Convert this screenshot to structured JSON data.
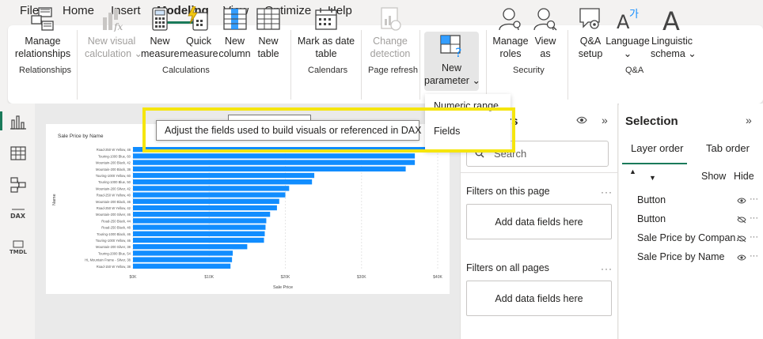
{
  "menu": {
    "items": [
      "File",
      "Home",
      "Insert",
      "Modeling",
      "View",
      "Optimize",
      "Help"
    ],
    "active": "Modeling"
  },
  "ribbon": {
    "manage_relationships": [
      "Manage",
      "relationships"
    ],
    "new_visual_calculation": [
      "New visual",
      "calculation ⌄"
    ],
    "new_measure": [
      "New",
      "measure"
    ],
    "quick_measure": [
      "Quick",
      "measure"
    ],
    "new_column": [
      "New",
      "column"
    ],
    "new_table": [
      "New",
      "table"
    ],
    "mark_as_date_table": [
      "Mark as date",
      "table"
    ],
    "change_detection": [
      "Change",
      "detection"
    ],
    "new_parameter": [
      "New",
      "parameter ⌄"
    ],
    "manage_roles": [
      "Manage",
      "roles"
    ],
    "view_as": [
      "View",
      "as"
    ],
    "qa_setup": [
      "Q&A",
      "setup"
    ],
    "language": [
      "Language",
      "⌄"
    ],
    "linguistic_schema": [
      "Linguistic",
      "schema ⌄"
    ],
    "groups": {
      "relationships": "Relationships",
      "calculations": "Calculations",
      "calendars": "Calendars",
      "page_refresh": "Page refresh",
      "security": "Security",
      "qa": "Q&A"
    }
  },
  "dropdown": {
    "items": [
      "Numeric range",
      "Fields"
    ]
  },
  "tooltip": {
    "text": "Adjust the fields used to build visuals or referenced in DAX"
  },
  "filters": {
    "title": "ers",
    "search_placeholder": "Search",
    "on_this_page": "Filters on this page",
    "on_all_pages": "Filters on all pages",
    "add_fields": "Add data fields here",
    "more": "···"
  },
  "selection": {
    "title": "Selection",
    "tabs": [
      "Layer order",
      "Tab order"
    ],
    "show": "Show",
    "hide": "Hide",
    "items": [
      {
        "name": "Button",
        "visible": true
      },
      {
        "name": "Button",
        "visible": false
      },
      {
        "name": "Sale Price by Compan…",
        "visible": false
      },
      {
        "name": "Sale Price by Name",
        "visible": true
      }
    ],
    "more": "···"
  },
  "chart_data": {
    "type": "bar",
    "title": "Sale Price by Name",
    "xlabel": "Sale Price",
    "ylabel": "Name",
    "xlim": [
      0,
      40000
    ],
    "xticks": [
      "$0K",
      "$10K",
      "$20K",
      "$30K",
      "$40K"
    ],
    "categories": [
      "Road-250 W Yellow, 48",
      "Touring-1000 Blue, 60",
      "Mountain-200 Black, 42",
      "Mountain-200 Black, 38",
      "Touring-1000 Yellow, 60",
      "Touring-1000 Blue, 50",
      "Mountain-200 Silver, 42",
      "Road-250 W Yellow, 40",
      "Mountain-200 Black, 46",
      "Road-250 W Yellow, 42",
      "Mountain-200 Silver, 46",
      "Road-250 Black, 44",
      "Road-250 Black, 48",
      "Touring-1000 Black, 46",
      "Touring-1000 Yellow, 46",
      "Mountain-200 Silver, 38",
      "Touring-2000 Blue, 54",
      "HL Mountain Frame - Silver, 38",
      "Road-150 W Yellow, 38"
    ],
    "values": [
      38500,
      37000,
      37000,
      35800,
      23800,
      23500,
      20500,
      20000,
      19200,
      18900,
      18000,
      17500,
      17400,
      17300,
      17200,
      15000,
      13100,
      13000,
      12800
    ],
    "color": "#118dff"
  },
  "colors": {
    "accent": "#1a7a5a",
    "highlight": "#f5e50e"
  }
}
